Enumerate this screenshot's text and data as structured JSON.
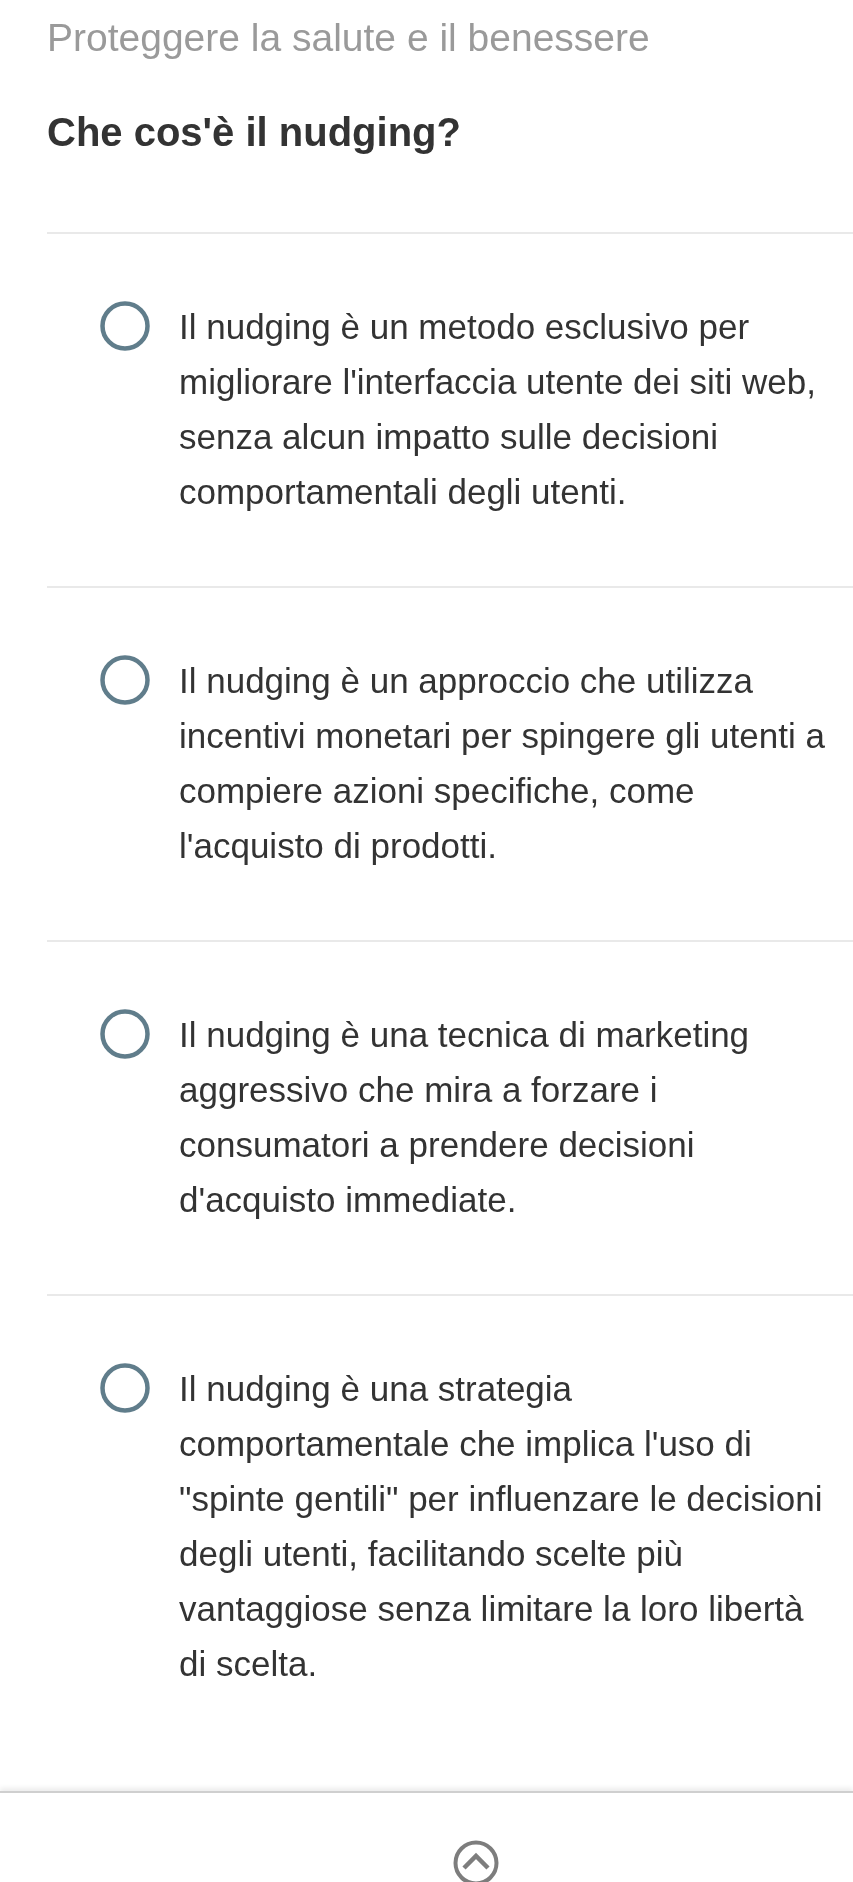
{
  "header": {
    "section": "Proteggere la salute e il benessere",
    "question": "Che cos'è il nudging?"
  },
  "options": [
    {
      "text": "Il nudging è un metodo esclusivo per migliorare l'interfaccia utente dei siti web, senza alcun impatto sulle decisioni comportamentali degli utenti.",
      "selected": false
    },
    {
      "text": "Il nudging è un approccio che utilizza incentivi monetari per spingere gli utenti a compiere azioni specifiche, come l'acquisto di prodotti.",
      "selected": false
    },
    {
      "text": "Il nudging è una tecnica di marketing aggressivo che mira a forzare i consumatori a prendere decisioni d'acquisto immediate.",
      "selected": false
    },
    {
      "text": "Il nudging è una strategia comportamentale che implica l'uso di \"spinte gentili\" per influenzare le decisioni degli utenti, facilitando scelte più vantaggiose senza limitare la loro libertà di scelta.",
      "selected": false
    }
  ]
}
